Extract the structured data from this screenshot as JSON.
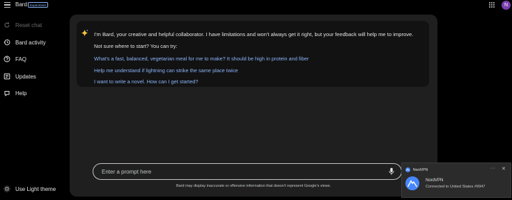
{
  "header": {
    "app_title": "Bard",
    "badge": "Experiment",
    "avatar_initial": "N"
  },
  "sidebar": {
    "items": [
      {
        "label": "Reset chat",
        "icon": "reset-icon",
        "enabled": false
      },
      {
        "label": "Bard activity",
        "icon": "history-icon",
        "enabled": true
      },
      {
        "label": "FAQ",
        "icon": "help-circle-icon",
        "enabled": true
      },
      {
        "label": "Updates",
        "icon": "updates-icon",
        "enabled": true
      },
      {
        "label": "Help",
        "icon": "help-icon",
        "enabled": true
      }
    ],
    "theme_toggle": "Use Light theme"
  },
  "intro": {
    "message": "I'm Bard, your creative and helpful collaborator. I have limitations and won't always get it right, but your feedback will help me to improve.",
    "suggest_heading": "Not sure where to start? You can try:",
    "suggestions": [
      "What's a fast, balanced, vegetarian meal for me to make? It should be high in protein and fiber",
      "Help me understand if lightning can strike the same place twice",
      "I want to write a novel. How can I get started?"
    ]
  },
  "prompt": {
    "placeholder": "Enter a prompt here",
    "disclaimer": "Bard may display inaccurate or offensive information that doesn't represent Google's views."
  },
  "notification": {
    "app": "NordVPN",
    "more": "···",
    "close": "✕",
    "title": "NordVPN",
    "message": "Connected to United States #9947"
  },
  "colors": {
    "background": "#000000",
    "panel": "#1f1f20",
    "card": "#121212",
    "link": "#8ab4f8",
    "avatar": "#7b3fb0",
    "nordvpn": "#4687ff"
  }
}
